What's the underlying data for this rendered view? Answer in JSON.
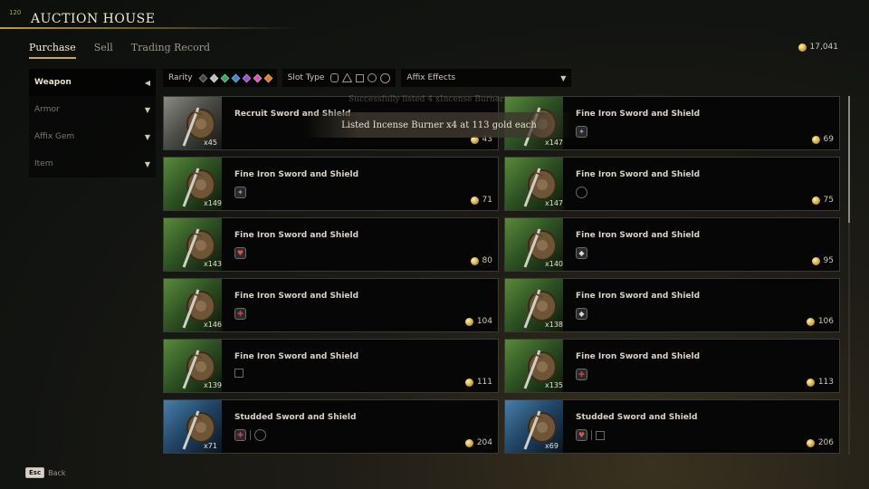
{
  "fps": "120",
  "header": {
    "title": "AUCTION HOUSE"
  },
  "tabs": [
    {
      "label": "Purchase",
      "active": true
    },
    {
      "label": "Sell",
      "active": false
    },
    {
      "label": "Trading Record",
      "active": false
    }
  ],
  "gold_total": "17,041",
  "sidebar": {
    "items": [
      {
        "label": "Weapon",
        "active": true,
        "caret": "◀"
      },
      {
        "label": "Armor",
        "active": false,
        "caret": "▼"
      },
      {
        "label": "Affix Gem",
        "active": false,
        "caret": "▼"
      },
      {
        "label": "Item",
        "active": false,
        "caret": "▼"
      }
    ]
  },
  "filters": {
    "rarity_label": "Rarity",
    "rarity_colors": [
      "#444444",
      "#bfbfbf",
      "#3aa657",
      "#3a86c8",
      "#9a4ad0",
      "#d05aa8",
      "#e07a2a"
    ],
    "slot_type_label": "Slot Type",
    "affix_label": "Affix Effects"
  },
  "listings": [
    {
      "name": "Recruit Sword and Shield",
      "qty": "x45",
      "price": "43",
      "rarity": "gray",
      "affixes": []
    },
    {
      "name": "Fine Iron Sword and Shield",
      "qty": "x147",
      "price": "69",
      "rarity": "green",
      "affixes": [
        "cross"
      ]
    },
    {
      "name": "Fine Iron Sword and Shield",
      "qty": "x149",
      "price": "71",
      "rarity": "green",
      "affixes": [
        "cross"
      ]
    },
    {
      "name": "Fine Iron Sword and Shield",
      "qty": "x147",
      "price": "75",
      "rarity": "green",
      "affixes": [
        "circle"
      ]
    },
    {
      "name": "Fine Iron Sword and Shield",
      "qty": "x143",
      "price": "80",
      "rarity": "green",
      "affixes": [
        "heart"
      ]
    },
    {
      "name": "Fine Iron Sword and Shield",
      "qty": "x140",
      "price": "95",
      "rarity": "green",
      "affixes": [
        "shield"
      ]
    },
    {
      "name": "Fine Iron Sword and Shield",
      "qty": "x146",
      "price": "104",
      "rarity": "green",
      "affixes": [
        "plus"
      ]
    },
    {
      "name": "Fine Iron Sword and Shield",
      "qty": "x138",
      "price": "106",
      "rarity": "green",
      "affixes": [
        "shield"
      ]
    },
    {
      "name": "Fine Iron Sword and Shield",
      "qty": "x139",
      "price": "111",
      "rarity": "green",
      "affixes": [
        "square"
      ]
    },
    {
      "name": "Fine Iron Sword and Shield",
      "qty": "x135",
      "price": "113",
      "rarity": "green",
      "affixes": [
        "plus"
      ]
    },
    {
      "name": "Studded Sword and Shield",
      "qty": "x71",
      "price": "204",
      "rarity": "blue",
      "affixes": [
        "plus",
        "sep",
        "circle"
      ]
    },
    {
      "name": "Studded Sword and Shield",
      "qty": "x69",
      "price": "206",
      "rarity": "blue",
      "affixes": [
        "heart",
        "sep",
        "square"
      ]
    }
  ],
  "toasts": {
    "faded": "Successfully listed 4 xIncense Burner",
    "main": "Listed Incense Burner x4 at 113 gold each"
  },
  "footer": {
    "key": "Esc",
    "label": "Back"
  }
}
